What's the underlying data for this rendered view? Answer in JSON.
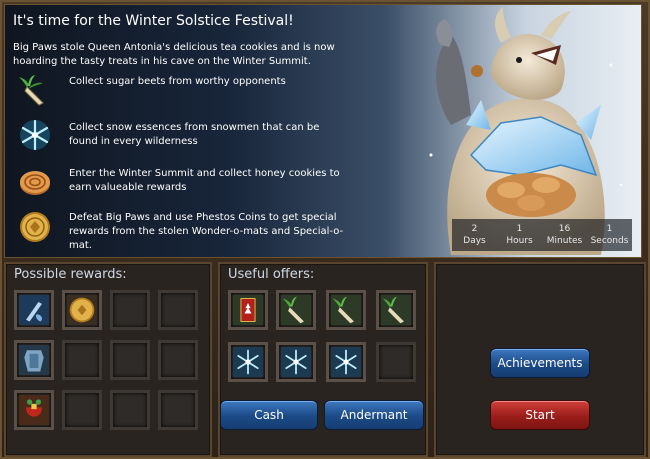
{
  "banner": {
    "title": "It's time for the Winter Solstice Festival!",
    "intro": "Big Paws stole Queen Antonia's delicious tea cookies and is now hoarding the tasty treats in his cave on the Winter Summit.",
    "tasks": [
      {
        "icon": "sugar-beet-icon",
        "text": "Collect sugar beets from worthy opponents"
      },
      {
        "icon": "snow-essence-icon",
        "text": "Collect snow essences from snowmen that can be found in every wilderness"
      },
      {
        "icon": "honey-cookie-icon",
        "text": "Enter the Winter Summit and collect honey cookies to earn valueable rewards"
      },
      {
        "icon": "phestos-coin-icon",
        "text": "Defeat Big Paws and use Phestos Coins to get special rewards from the stolen Wonder-o-mats and Special-o-mat."
      }
    ]
  },
  "timer": {
    "days_value": "2",
    "days_label": "Days",
    "hours_value": "1",
    "hours_label": "Hours",
    "minutes_value": "16",
    "minutes_label": "Minutes",
    "seconds_value": "1",
    "seconds_label": "Seconds"
  },
  "rewards": {
    "title": "Possible rewards:",
    "items": [
      "blue-tools-icon",
      "phestos-coin-icon",
      "blue-armor-icon",
      "gift-sack-icon"
    ]
  },
  "offers": {
    "title": "Useful offers:",
    "items": [
      "red-banner-icon",
      "sugar-beet-icon",
      "sugar-beet-icon",
      "sugar-beet-icon",
      "snow-essence-icon",
      "snow-essence-icon",
      "snow-essence-icon"
    ],
    "cash_label": "Cash",
    "andermant_label": "Andermant"
  },
  "actions": {
    "achievements_label": "Achievements",
    "start_label": "Start"
  },
  "colors": {
    "button_blue": "#1b4a86",
    "button_red": "#9a1d1a",
    "frame": "#5a4530"
  }
}
